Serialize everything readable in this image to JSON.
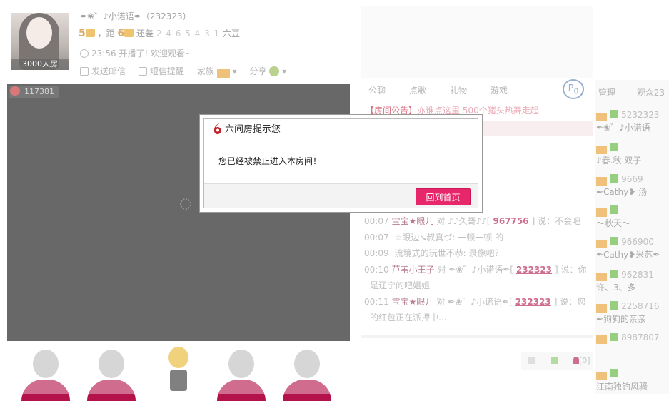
{
  "room": {
    "anchor_name": "✒❀゛♪小诺语✒（232323）",
    "level_current": "5",
    "level_next_label": "，距",
    "level_next": "6",
    "remain_label": "还差",
    "remain_digits": "2 4 6 5 4 3 1",
    "currency": "六豆",
    "time": "23:56",
    "live_msg": "开播了! 欢迎观看~",
    "avatar_caption": "3000人房",
    "actions": {
      "fly_letter": "发送邮信",
      "sms": "短信提醒",
      "family": "家族",
      "share": "分享"
    },
    "hot_count": "117381"
  },
  "tabs": {
    "main": [
      "公聊",
      "点歌",
      "礼物",
      "游戏"
    ],
    "side": [
      "管理",
      "观众23"
    ]
  },
  "notice": {
    "label": "【房间公告】",
    "text": "亦谁点这里",
    "text2": "500个猪头热舞走起"
  },
  "chat": [
    {
      "time": "00:07",
      "user": "宝宝★眼儿",
      "mid": "对 ♪♪久哥♪♪[",
      "link": "967756",
      "tail": "] 说：不会吧"
    },
    {
      "time": "00:07",
      "user": "",
      "mid": "☆眼边↘叔真づ: 一顿一顿 的",
      "link": "",
      "tail": ""
    },
    {
      "time": "00:09",
      "user": "",
      "mid": "流境式的玩世不恭: 录像吧？",
      "link": "",
      "tail": ""
    },
    {
      "time": "00:10",
      "user": "芦苇小王子",
      "mid": "对 ✒❀゛♪小诺语✒[",
      "link": "232323",
      "tail": "] 说：你"
    },
    {
      "time": "",
      "user": "",
      "mid": "是辽宁的吧姐姐",
      "link": "",
      "tail": ""
    },
    {
      "time": "00:11",
      "user": "宝宝★眼儿",
      "mid": "对 ✒❀゛♪小诺语✒[",
      "link": "232323",
      "tail": "] 说：您"
    },
    {
      "time": "",
      "user": "",
      "mid": "的红包正在派押中...",
      "link": "",
      "tail": ""
    }
  ],
  "input_count": "[0]",
  "side_users": [
    {
      "num": "5",
      "name": "232323",
      "sub": "✒❀゛♪小诺语"
    },
    {
      "num": "",
      "name": "",
      "sub": "♪春.秋.双子"
    },
    {
      "num": "",
      "name": "9669",
      "sub": "✒Cathy❥ 汤"
    },
    {
      "num": "",
      "name": "",
      "sub": "～秋天～"
    },
    {
      "num": "",
      "name": "966900",
      "sub": "✒Cathy❥米苏✒"
    },
    {
      "num": "",
      "name": "962831",
      "sub": "许、3、多"
    },
    {
      "num": "",
      "name": "2258716",
      "sub": "✒狗狗的亲亲"
    },
    {
      "num": "",
      "name": "8987807",
      "sub": ""
    },
    {
      "num": "",
      "name": "",
      "sub": "江南独钓风骚"
    }
  ],
  "dialog": {
    "title": "六间房提示您",
    "message": "您已经被禁止进入本房间！",
    "button": "回到首页"
  },
  "colors": {
    "accent": "#e8266a",
    "brand": "#c4242b"
  }
}
